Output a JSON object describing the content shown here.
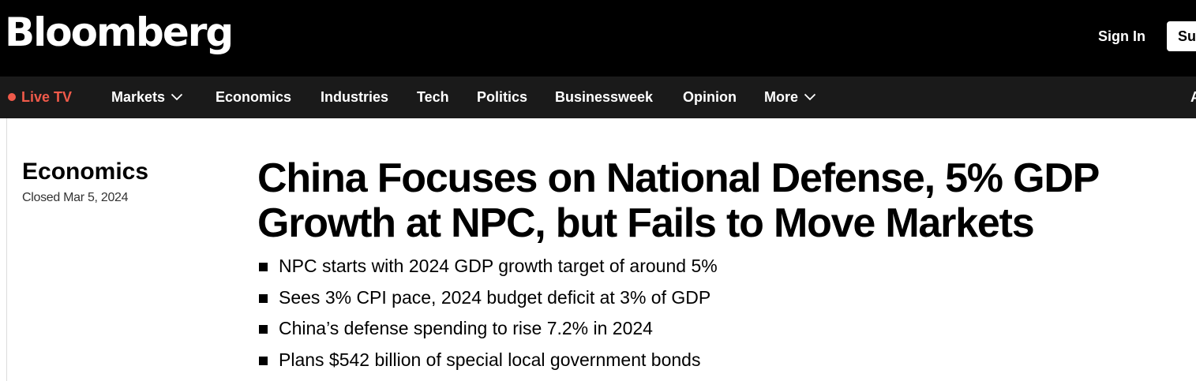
{
  "header": {
    "logo": "Bloomberg",
    "sign_in": "Sign In",
    "subscribe": "Subscribe"
  },
  "nav": {
    "live_tv": "Live TV",
    "items": [
      {
        "label": "Markets",
        "has_dropdown": true
      },
      {
        "label": "Economics",
        "has_dropdown": false
      },
      {
        "label": "Industries",
        "has_dropdown": false
      },
      {
        "label": "Tech",
        "has_dropdown": false
      },
      {
        "label": "Politics",
        "has_dropdown": false
      },
      {
        "label": "Businessweek",
        "has_dropdown": false
      },
      {
        "label": "Opinion",
        "has_dropdown": false
      },
      {
        "label": "More",
        "has_dropdown": true
      }
    ],
    "cut_off": "A"
  },
  "article": {
    "section": "Economics",
    "status": "Closed Mar 5, 2024",
    "headline": "China Focuses on National Defense, 5% GDP Growth at NPC, but Fails to Move Markets",
    "bullets": [
      "NPC starts with 2024 GDP growth target of around 5%",
      "Sees 3% CPI pace, 2024 budget deficit at 3% of GDP",
      "China’s defense spending to rise 7.2% in 2024",
      "Plans $542 billion of special local government bonds"
    ]
  },
  "colors": {
    "header_bg": "#000000",
    "nav_bg": "#1a1a1a",
    "live_accent": "#f05a4a"
  },
  "icons": {
    "dropdown": "chevron-down-icon",
    "live": "live-dot-icon",
    "bullet": "square-bullet-icon"
  }
}
